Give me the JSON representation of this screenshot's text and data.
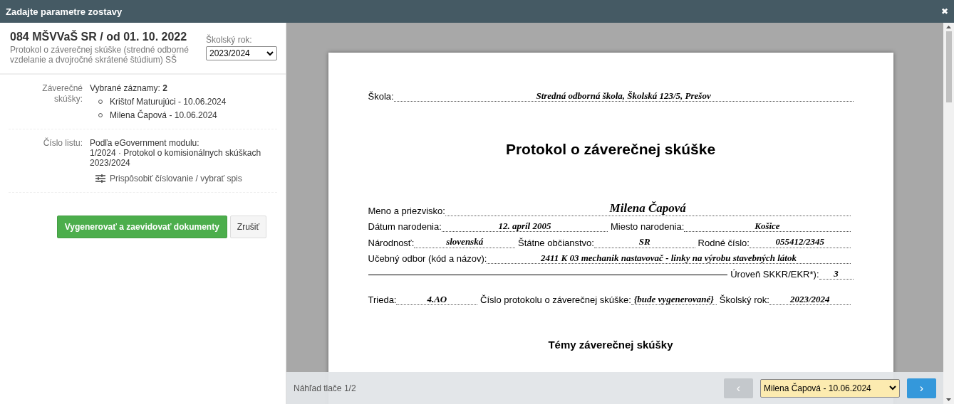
{
  "window": {
    "title": "Zadajte parametre zostavy",
    "close": "✖"
  },
  "report": {
    "title": "084 MŠVVaŠ SR / od 01. 10. 2022",
    "subtitle": "Protokol o záverečnej skúške (stredné odborné vzdelanie a dvojročné skrátené štúdium) SŠ",
    "year_label": "Školský rok:",
    "year_value": "2023/2024"
  },
  "exams": {
    "label": "Záverečné skúšky:",
    "summary": "Vybrané záznamy: **2**",
    "items": [
      "Krištof Maturujúci - 10.06.2024",
      "Milena Čapová - 10.06.2024"
    ]
  },
  "sheet": {
    "label": "Číslo listu:",
    "lines": [
      "Podľa eGovernment modulu:",
      "1/2024 · Protokol o komisionálnych skúškach 2023/2024"
    ],
    "customize": "Prispôsobiť číslovanie / vybrať spis"
  },
  "buttons": {
    "generate": "Vygenerovať a zaevidovať dokumenty",
    "cancel": "Zrušiť"
  },
  "document": {
    "school_label": "Škola:",
    "school_value": "Stredná odborná škola, Školská 123/5, Prešov",
    "title": "Protokol o záverečnej skúške",
    "rows": [
      [
        {
          "label": "Meno a priezvisko:",
          "value": "Milena Čapová",
          "kind": "big"
        }
      ],
      [
        {
          "label": "Dátum narodenia:",
          "value": "12. apríl 2005",
          "kind": "field"
        },
        {
          "label": "Miesto narodenia:",
          "value": "Košice",
          "kind": "field"
        }
      ],
      [
        {
          "label": "Národnosť:",
          "value": "slovenská",
          "kind": "field"
        },
        {
          "label": "Štátne občianstvo:",
          "value": "SR",
          "kind": "field"
        },
        {
          "label": "Rodné číslo:",
          "value": "055412/2345",
          "kind": "field"
        }
      ],
      [
        {
          "label": "Učebný odbor (kód a názov):",
          "value": "2411 K 03 mechanik nastavovač - linky na výrobu stavebných látok",
          "kind": "field"
        }
      ],
      [
        {
          "kind": "line"
        },
        {
          "label": "Úroveň SKKR/EKR*):",
          "value": "3",
          "kind": "small"
        }
      ],
      [
        {
          "label": "Trieda:",
          "value": "4.AO",
          "kind": "field"
        },
        {
          "label": "Číslo protokolu o záverečnej skúške:",
          "value": "{bude vygenerované}",
          "kind": "wrap"
        },
        {
          "label": "Školský rok:",
          "value": "2023/2024",
          "kind": "field"
        }
      ]
    ],
    "section": "Témy záverečnej skúšky"
  },
  "pager": {
    "label": "Náhľad tlače 1/2",
    "prev": "‹",
    "prev_disabled": true,
    "selected": "Milena Čapová - 10.06.2024",
    "next": "›"
  }
}
